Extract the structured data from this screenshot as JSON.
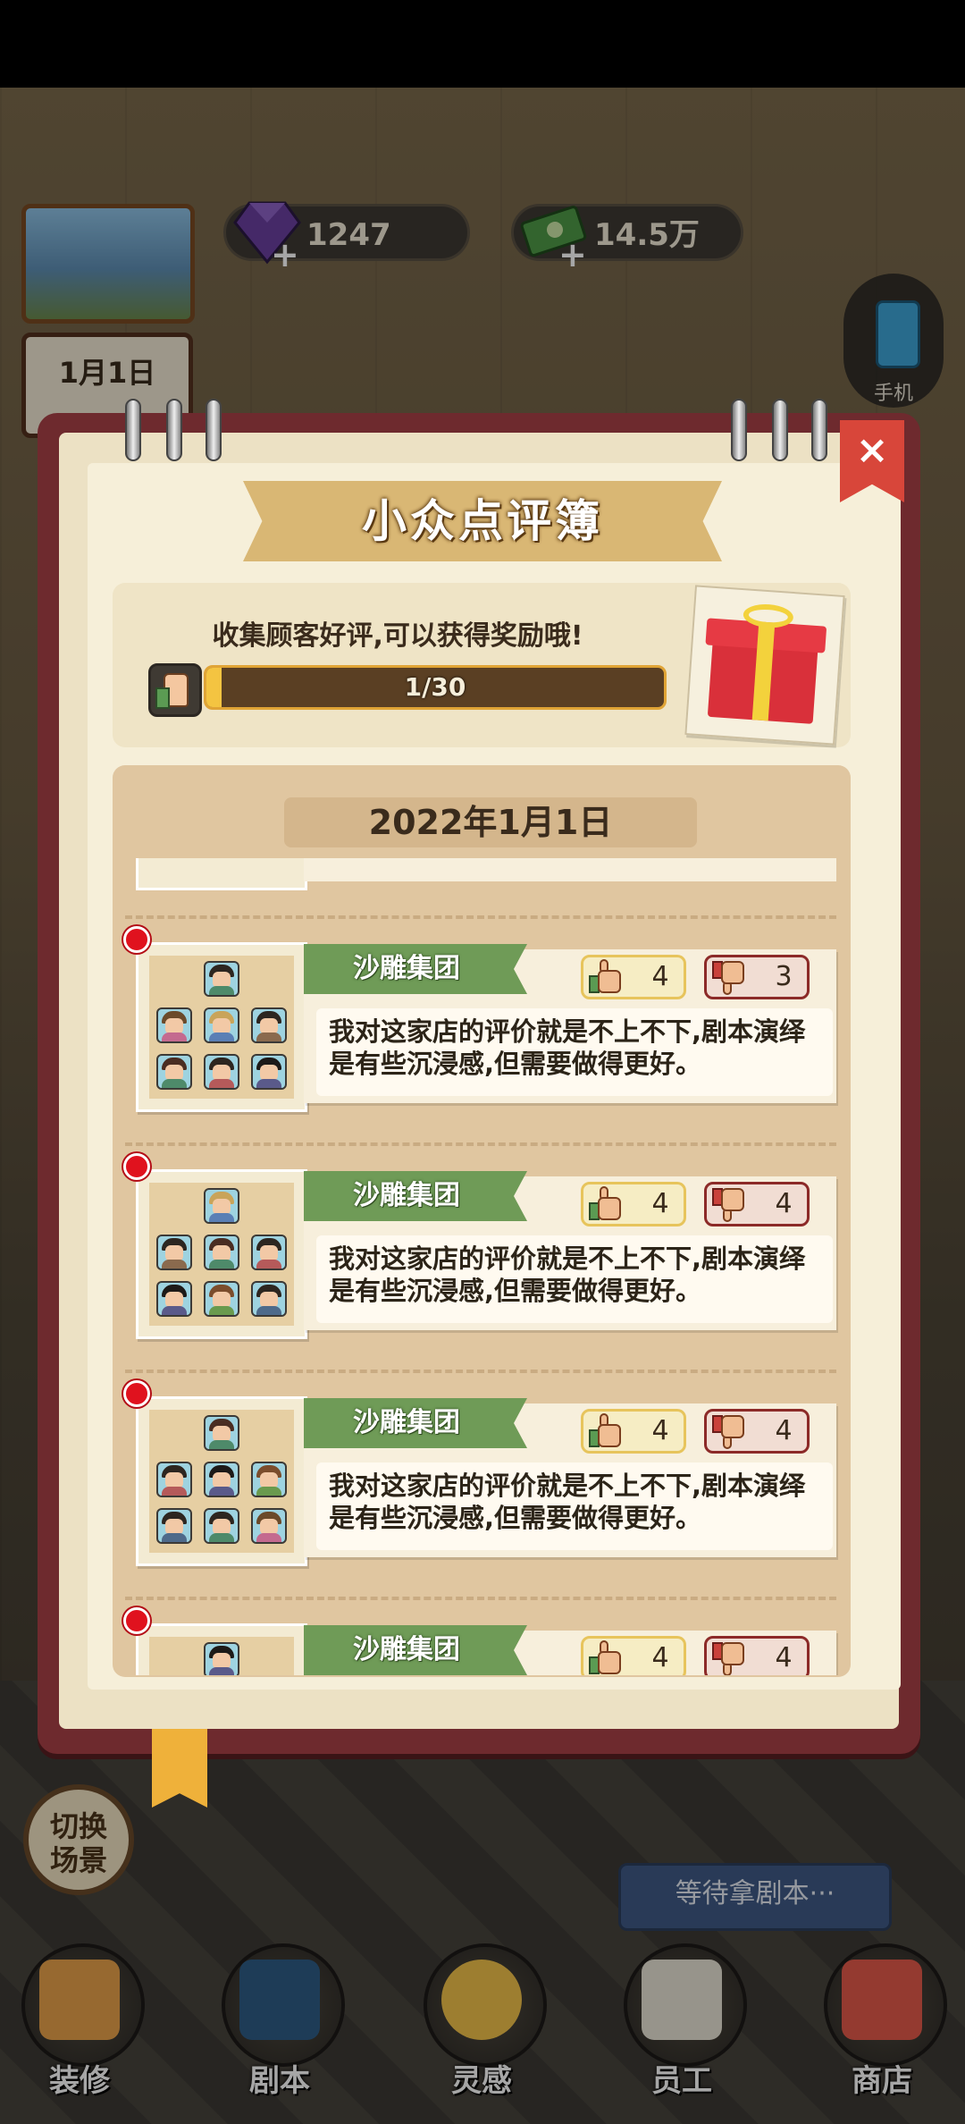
{
  "hud": {
    "gems": "1247",
    "cash": "14.5万",
    "date": "1月1日",
    "phone_label": "手机"
  },
  "dialog": {
    "title": "小众点评簿",
    "close": "×",
    "reward_tip": "收集顾客好评,可以获得奖励哦!",
    "progress_text": "1/30",
    "progress_value": 0.0333,
    "date_header": "2022年1月1日"
  },
  "reviews": [
    {
      "name": "沙雕集团",
      "likes": "4",
      "dislikes": "3",
      "comment": "我对这家店的评价就是不上不下,剧本演绎是有些沉浸感,但需要做得更好。"
    },
    {
      "name": "沙雕集团",
      "likes": "4",
      "dislikes": "4",
      "comment": "我对这家店的评价就是不上不下,剧本演绎是有些沉浸感,但需要做得更好。"
    },
    {
      "name": "沙雕集团",
      "likes": "4",
      "dislikes": "4",
      "comment": "我对这家店的评价就是不上不下,剧本演绎是有些沉浸感,但需要做得更好。"
    },
    {
      "name": "沙雕集团",
      "likes": "4",
      "dislikes": "4",
      "comment": ""
    }
  ],
  "scene": {
    "switch_label": "切换\n场景",
    "waiting_label": "等待拿剧本···"
  },
  "nav": {
    "decorate": "装修",
    "script": "剧本",
    "inspiration": "灵感",
    "staff": "员工",
    "shop": "商店"
  },
  "colors": {
    "accent_green": "#6f9b57",
    "notebook_border": "#6e2a2e",
    "red_dot": "#e0121e",
    "progress_gold": "#f4c441"
  }
}
